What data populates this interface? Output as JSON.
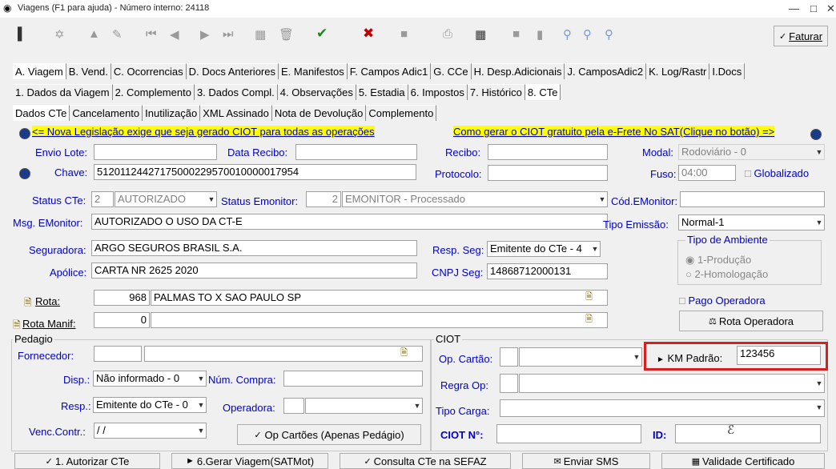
{
  "window": {
    "title": "Viagens (F1 para ajuda) - Número interno: 24118"
  },
  "toolbar": {
    "faturar_label": "Faturar"
  },
  "tabs_main": [
    "A. Viagem",
    "B. Vend.",
    "C. Ocorrencias",
    "D. Docs Anteriores",
    "E. Manifestos",
    "F. Campos Adic1",
    "G. CCe",
    "H. Desp.Adicionais",
    "J. CamposAdic2",
    "K. Log/Rastr",
    "I.Docs"
  ],
  "tabs_sub": [
    "1. Dados da Viagem",
    "2. Complemento",
    "3. Dados Compl.",
    "4. Observações",
    "5. Estadia",
    "6. Impostos",
    "7. Histórico",
    "8. CTe"
  ],
  "tabs_cte": [
    "Dados CTe",
    "Cancelamento",
    "Inutilização",
    "XML Assinado",
    "Nota de Devolução",
    "Complemento"
  ],
  "links": {
    "ciot_legislacao": "<= Nova Legislação exige que seja gerado CIOT para todas as operações",
    "ciot_gratuito": "Como gerar o CIOT gratuito pela e-Frete No SAT(Clique no botão) =>"
  },
  "fields": {
    "envio_lote_label": "Envio Lote:",
    "envio_lote": "",
    "data_recibo_label": "Data Recibo:",
    "data_recibo": "",
    "recibo_label": "Recibo:",
    "recibo": "",
    "modal_label": "Modal:",
    "modal": "Rodoviário - 0",
    "chave_label": "Chave:",
    "chave": "51201124427175000229570010000017954",
    "protocolo_label": "Protocolo:",
    "protocolo": "",
    "fuso_label": "Fuso:",
    "fuso": "04:00",
    "globalizado_label": "Globalizado",
    "status_cte_label": "Status CTe:",
    "status_cte_code": "2",
    "status_cte": "AUTORIZADO",
    "status_emonitor_label": "Status Emonitor:",
    "status_emonitor_code": "2",
    "status_emonitor": "EMONITOR - Processado",
    "cod_emonitor_label": "Cód.EMonitor:",
    "cod_emonitor": "",
    "msg_emonitor_label": "Msg. EMonitor:",
    "msg_emonitor": "AUTORIZADO O USO DA CT-E",
    "tipo_emissao_label": "Tipo Emissão:",
    "tipo_emissao": "Normal-1",
    "seguradora_label": "Seguradora:",
    "seguradora": "ARGO SEGUROS BRASIL S.A.",
    "resp_seg_label": "Resp. Seg:",
    "resp_seg": "Emitente do CTe - 4",
    "apolice_label": "Apólice:",
    "apolice": "CARTA NR 2625 2020",
    "cnpj_seg_label": "CNPJ Seg:",
    "cnpj_seg": "14868712000131",
    "rota_label": "Rota:",
    "rota_code": "968",
    "rota": "PALMAS TO X SAO PAULO SP",
    "pago_operadora_label": "Pago Operadora",
    "rota_manif_label": "Rota Manif:",
    "rota_manif_code": "0",
    "rota_manif": ""
  },
  "tipo_ambiente": {
    "title": "Tipo de Ambiente",
    "option1": "1-Produção",
    "option2": "2-Homologação"
  },
  "rota_operadora_label": "Rota Operadora",
  "pedagio": {
    "title": "Pedagio",
    "fornecedor_label": "Fornecedor:",
    "fornecedor_code": "",
    "fornecedor": "",
    "disp_label": "Disp.:",
    "disp": "Não informado - 0",
    "num_compra_label": "Núm. Compra:",
    "num_compra": "",
    "resp_label": "Resp.:",
    "resp": "Emitente do CTe - 0",
    "operadora_label": "Operadora:",
    "operadora": "",
    "venc_contr_label": "Venc.Contr.:",
    "venc_contr": "/ /",
    "op_cartoes_label": "Op Cartões (Apenas Pedágio)"
  },
  "ciot": {
    "title": "CIOT",
    "op_cartao_label": "Op. Cartão:",
    "op_cartao": "",
    "km_padrao_label": "KM Padrão:",
    "km_padrao": "123456",
    "regra_op_label": "Regra Op:",
    "regra_op": "",
    "tipo_carga_label": "Tipo Carga:",
    "tipo_carga": "",
    "ciot_n_label": "CIOT N°:",
    "ciot_n": "",
    "id_label": "ID:",
    "id": ""
  },
  "bottom_buttons": {
    "autorizar": "1. Autorizar CTe",
    "gerar_viagem": "6.Gerar Viagem(SATMot)",
    "consulta": "Consulta CTe na SEFAZ",
    "enviar_sms": "Enviar SMS",
    "validade": "Validade Certificado"
  },
  "colors": {
    "label_blue": "#0000cc",
    "link_highlight": "#ffff00",
    "highlight_box": "#d92020"
  }
}
